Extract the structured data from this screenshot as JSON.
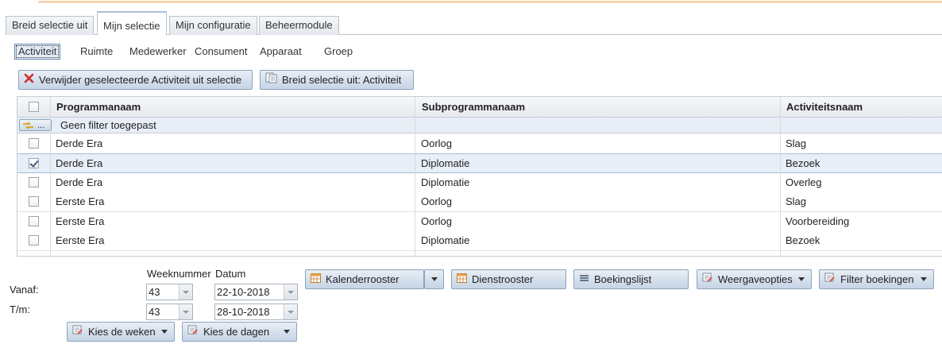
{
  "tabs": [
    "Breid selectie uit",
    "Mijn selectie",
    "Mijn configuratie",
    "Beheermodule"
  ],
  "subtabs": [
    "Activiteit",
    "Ruimte",
    "Medewerker",
    "Consument",
    "Apparaat",
    "Groep"
  ],
  "actions": {
    "remove": "Verwijder geselecteerde Activiteit uit selectie",
    "extend": "Breid selectie uit: Activiteit"
  },
  "grid": {
    "headers": [
      "Programmanaam",
      "Subprogrammanaam",
      "Activiteitsnaam"
    ],
    "filter_button": "...",
    "filter_text": "Geen filter toegepast",
    "rows": [
      {
        "c1": "Derde Era",
        "c2": "Oorlog",
        "c3": "Slag"
      },
      {
        "c1": "Derde Era",
        "c2": "Diplomatie",
        "c3": "Bezoek"
      },
      {
        "c1": "Derde Era",
        "c2": "Diplomatie",
        "c3": "Overleg"
      },
      {
        "c1": "Eerste Era",
        "c2": "Oorlog",
        "c3": "Slag"
      },
      {
        "c1": "Eerste Era",
        "c2": "Oorlog",
        "c3": "Voorbereiding"
      },
      {
        "c1": "Eerste Era",
        "c2": "Diplomatie",
        "c3": "Bezoek"
      }
    ]
  },
  "dates": {
    "week_header": "Weeknummer",
    "date_header": "Datum",
    "from_label": "Vanaf:",
    "to_label": "T/m:",
    "from_week": "43",
    "from_date": "22-10-2018",
    "to_week": "43",
    "to_date": "28-10-2018",
    "choose_weeks": "Kies de weken",
    "choose_days": "Kies de dagen"
  },
  "views": {
    "calendar": "Kalenderrooster",
    "duty": "Dienstrooster",
    "booking_list": "Boekingslijst",
    "display_options": "Weergaveopties",
    "filter_bookings": "Filter boekingen"
  },
  "colors": {
    "accent": "#a9bfd4",
    "button": "#c5d4e6",
    "selected_row": "#e7eef7",
    "warning_bar": "#e9a95a"
  }
}
